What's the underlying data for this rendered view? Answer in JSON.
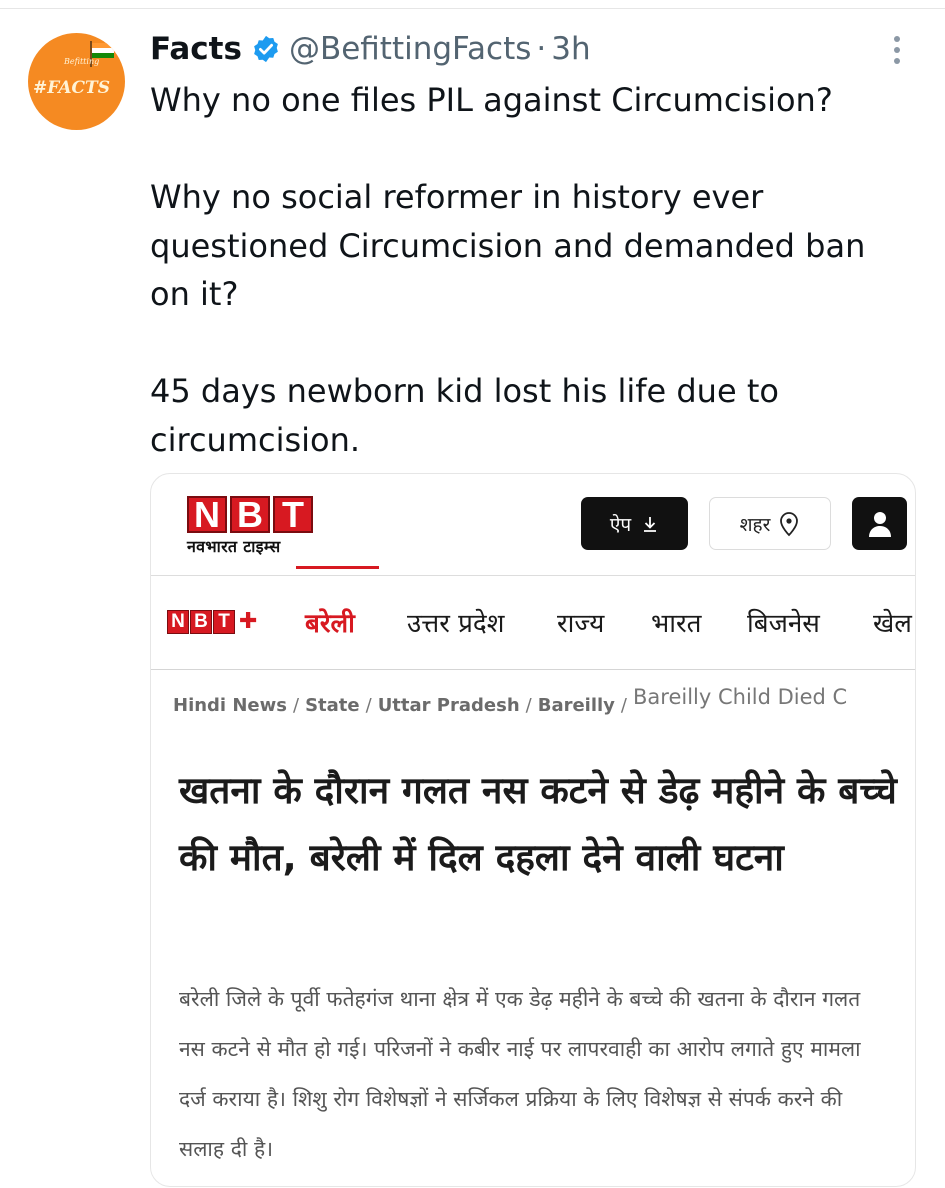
{
  "tweet": {
    "author_name": "Facts",
    "handle": "@BefittingFacts",
    "separator": "·",
    "time": "3h",
    "avatar": {
      "small_text": "Befitting",
      "text": "#FACTS",
      "color": "#f58a22"
    },
    "paragraphs": [
      "Why no one files PIL against Circumcision?",
      "Why no social reformer in history ever questioned Circumcision and demanded ban on it?",
      "45 days newborn kid lost his life due to circumcision."
    ],
    "icons": {
      "verified": "verified-badge-icon",
      "more": "more-options-icon"
    }
  },
  "card": {
    "logo_letters": [
      "N",
      "B",
      "T"
    ],
    "logo_subtitle": "नवभारत टाइम्स",
    "app_button": "ऐप",
    "city_button": "शहर",
    "nav_logo": [
      "N",
      "B",
      "T"
    ],
    "nav_items": [
      "बरेली",
      "उत्तर प्रदेश",
      "राज्य",
      "भारत",
      "बिजनेस",
      "खेल"
    ],
    "nav_active": "बरेली",
    "breadcrumb": [
      "Hindi News",
      "State",
      "Uttar Pradesh",
      "Bareilly",
      "Bareilly Child Died C"
    ],
    "headline": "खतना के दौरान गलत नस कटने से डेढ़ महीने के बच्चे की मौत, बरेली में दिल दहला देने वाली घटना",
    "summary": "बरेली जिले के पूर्वी फतेहगंज थाना क्षेत्र में एक डेढ़ महीने के बच्चे की खतना के दौरान गलत नस कटने से मौत हो गई। परिजनों ने कबीर नाई पर लापरवाही का आरोप लगाते हुए मामला दर्ज कराया है। शिशु रोग विशेषज्ञों ने सर्जिकल प्रक्रिया के लिए विशेषज्ञ से संपर्क करने की सलाह दी है।",
    "colors": {
      "brand_red": "#d71921",
      "dark": "#111111"
    }
  }
}
